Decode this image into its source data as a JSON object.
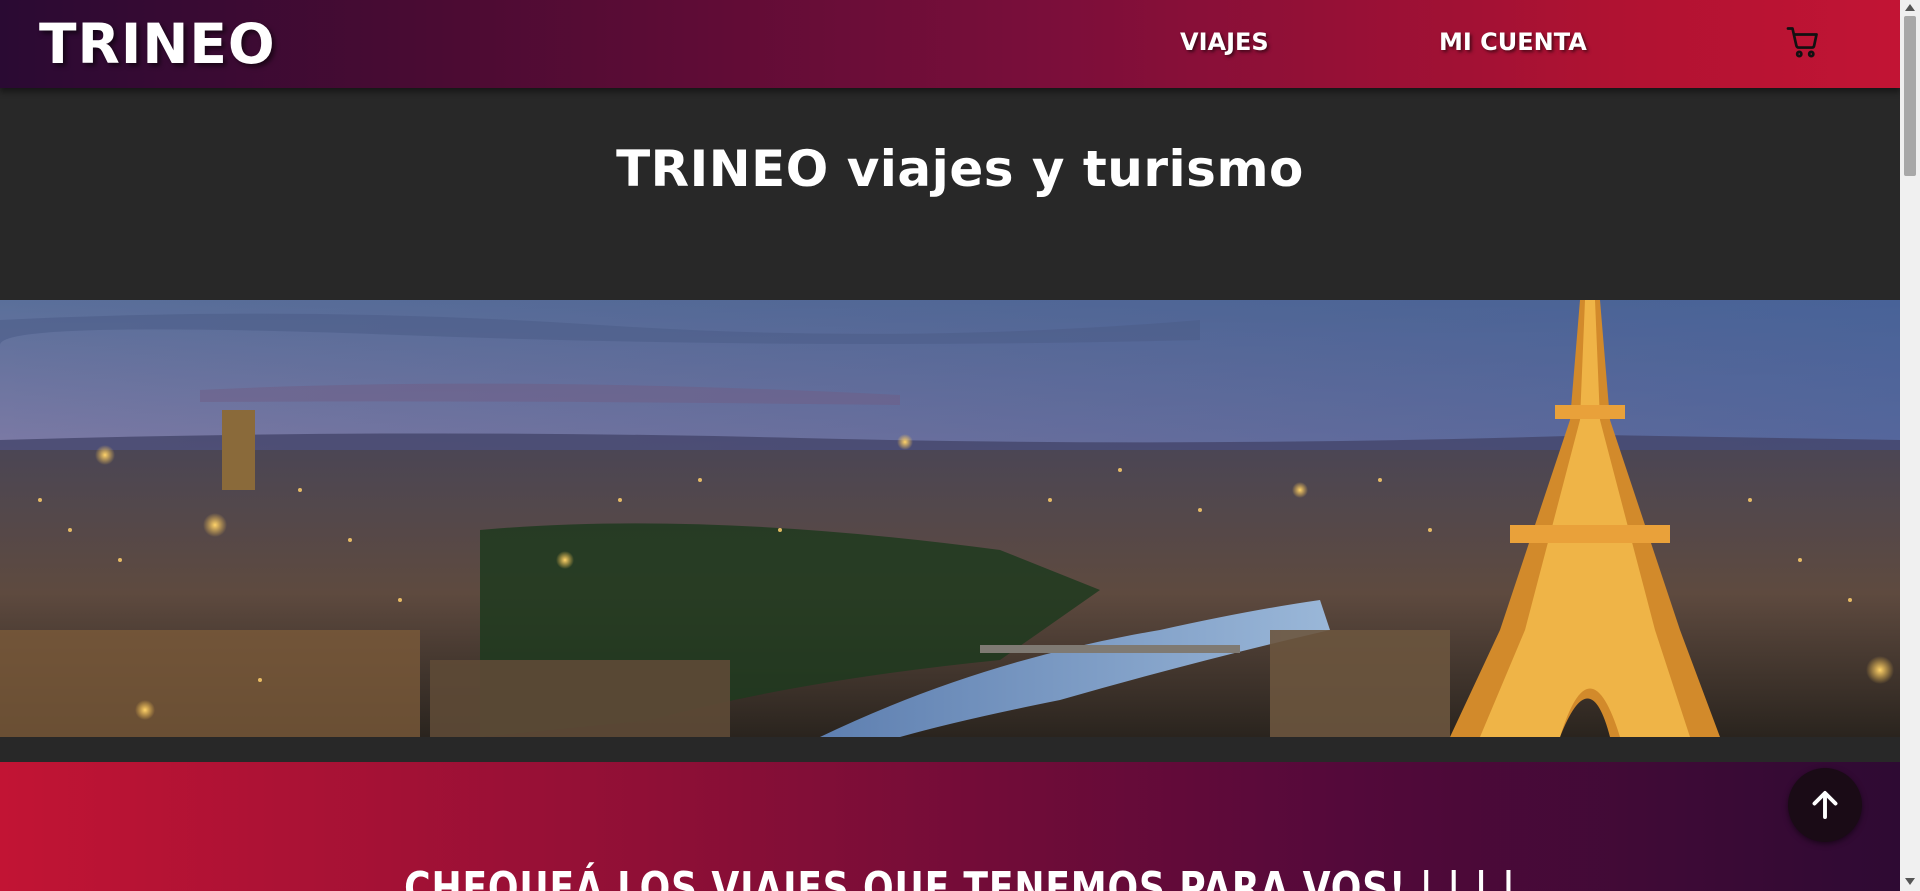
{
  "header": {
    "brand": "TRINEO",
    "nav": {
      "trips": "VIAJES",
      "account": "MI CUENTA"
    },
    "cart_icon": "shopping-cart-icon"
  },
  "main": {
    "title": "TRINEO viajes y turismo",
    "hero_image": "paris-night-skyline-with-eiffel-tower",
    "promo_text": "CHEQUEÁ LOS VIAJES QUE TENEMOS PARA VOS! | | | |"
  },
  "controls": {
    "back_to_top_icon": "arrow-up-icon"
  },
  "colors": {
    "header_gradient_start": "#2a0a33",
    "header_gradient_end": "#c21434",
    "page_background": "#282828"
  }
}
